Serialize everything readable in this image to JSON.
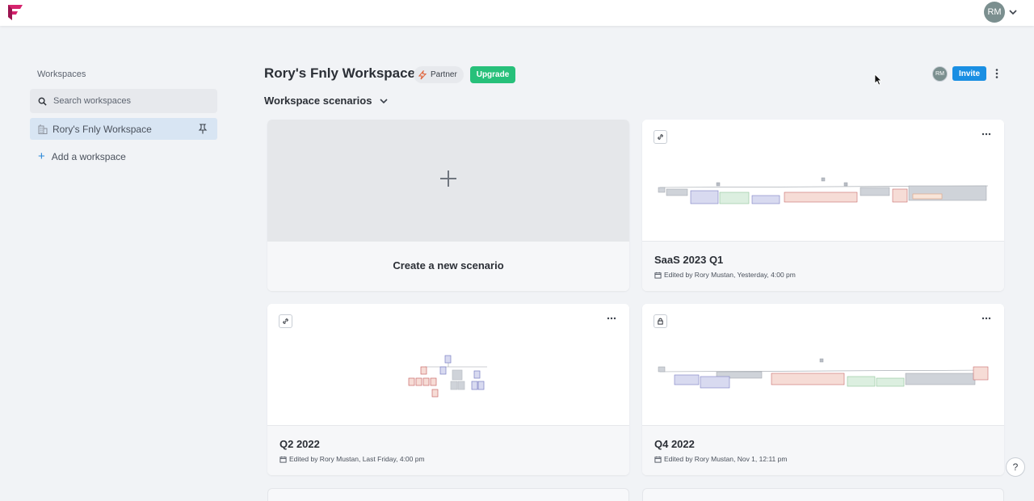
{
  "topbar": {
    "user_initials": "RM"
  },
  "sidebar": {
    "title": "Workspaces",
    "search_placeholder": "Search workspaces",
    "workspaces": [
      {
        "label": "Rory's Fnly Workspace"
      }
    ],
    "add_label": "Add a workspace"
  },
  "header": {
    "title": "Rory's Fnly Workspace",
    "partner_label": "Partner",
    "upgrade_label": "Upgrade",
    "member_initials": "RM",
    "invite_label": "Invite",
    "scenarios_title": "Workspace scenarios"
  },
  "create_card": {
    "label": "Create a new scenario"
  },
  "scenarios": [
    {
      "name": "SaaS 2023 Q1",
      "meta": "Edited by Rory Mustan, Yesterday, 4:00 pm",
      "access_icon": "link-icon"
    },
    {
      "name": "Q2 2022",
      "meta": "Edited by Rory Mustan, Last Friday, 4:00 pm",
      "access_icon": "link-icon"
    },
    {
      "name": "Q4 2022",
      "meta": "Edited by Rory Mustan, Nov 1, 12:11 pm",
      "access_icon": "lock-icon"
    }
  ],
  "help": {
    "label": "?"
  },
  "colors": {
    "brand": "#d6246e",
    "accent": "#1a8fe3",
    "upgrade": "#27c07a",
    "selected_bg": "#d8e5f3",
    "org_purple": "#7b7fc4",
    "org_red": "#c96a6a",
    "org_green": "#8fc49a",
    "org_gray": "#b9bec6",
    "org_orange": "#e0a080"
  }
}
